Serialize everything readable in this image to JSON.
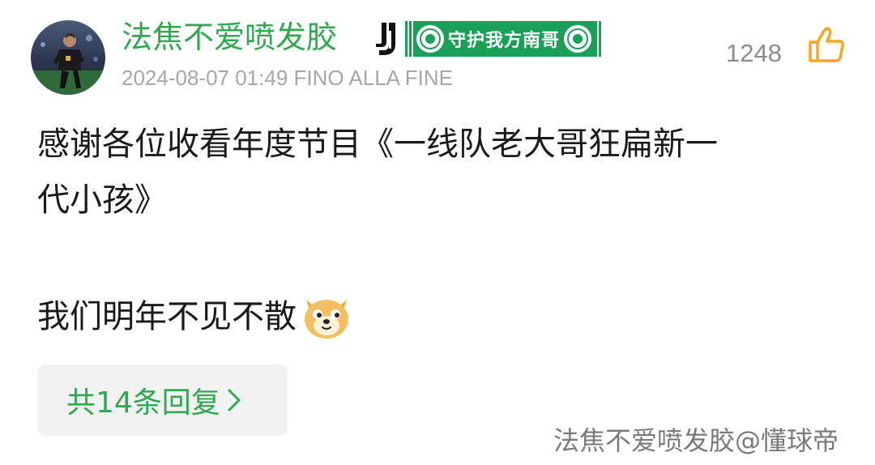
{
  "comment": {
    "username": "法焦不爱喷发胶",
    "scarf_text": "守护我方南哥",
    "meta": "2024-08-07 01:49 FINO ALLA FINE",
    "like_count": "1248",
    "body_lines": [
      "感谢各位收看年度节目《一线队老大哥狂扁新一",
      "代小孩》",
      "我们明年不见不散"
    ],
    "reply_label": "共14条回复"
  },
  "watermark": "法焦不爱喷发胶@懂球帝",
  "icons": {
    "team": "juventus-logo-icon",
    "like": "thumbs-up-icon",
    "emoji": "doge-emoji-icon",
    "reply_chevron": "chevron-right-icon"
  },
  "colors": {
    "username": "#2fa84f",
    "scarf": "#1ba157",
    "like_icon": "#f5a623",
    "meta": "#a6a6a6",
    "reply_bg": "#f2f2f2"
  }
}
